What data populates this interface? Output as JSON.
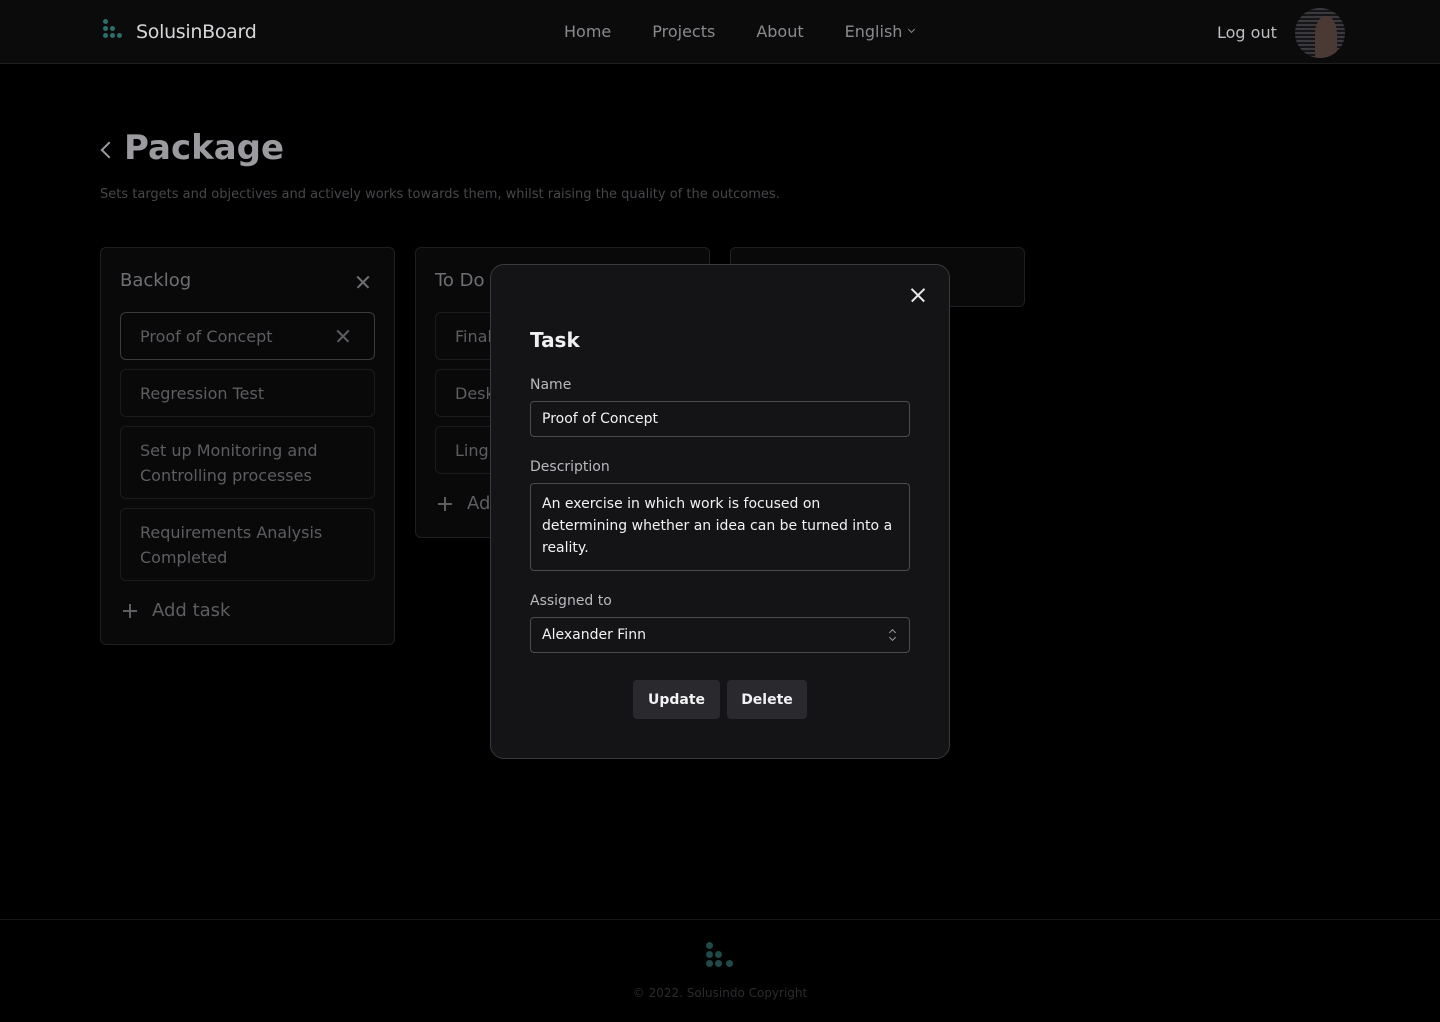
{
  "header": {
    "brand": "SolusinBoard",
    "nav": [
      "Home",
      "Projects",
      "About"
    ],
    "language": "English",
    "logout": "Log out"
  },
  "page": {
    "title": "Package",
    "description": "Sets targets and objectives and actively works towards them, whilst raising the quality of the outcomes."
  },
  "board": {
    "backlog": {
      "title": "Backlog",
      "cards": [
        "Proof of Concept",
        "Regression Test",
        "Set up Monitoring and Controlling processes",
        "Requirements Analysis Completed"
      ],
      "add_label": "Add task"
    },
    "todo": {
      "title": "To Do",
      "cards": [
        "Final",
        "Desk",
        "Lingu"
      ],
      "add_label": "Ad"
    }
  },
  "modal": {
    "title": "Task",
    "name_label": "Name",
    "name_value": "Proof of Concept",
    "description_label": "Description",
    "description_value": "An exercise in which work is focused on determining whether an idea can be turned into a reality.",
    "assigned_label": "Assigned to",
    "assigned_value": "Alexander Finn",
    "update_label": "Update",
    "delete_label": "Delete"
  },
  "footer": {
    "copyright": "© 2022. Solusindo Copyright"
  }
}
